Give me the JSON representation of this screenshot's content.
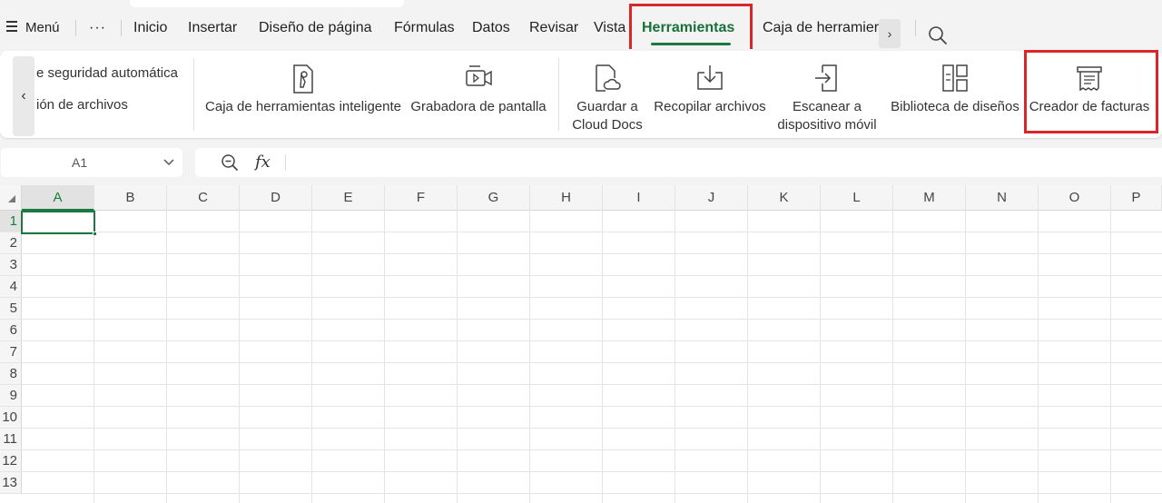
{
  "menubar": {
    "menu_label": "Menú",
    "more_label": "···",
    "tabs": [
      "Inicio",
      "Insertar",
      "Diseño de página",
      "Fórmulas",
      "Datos",
      "Revisar",
      "Vista",
      "Herramientas",
      "Caja de herramier"
    ],
    "active_tab": "Herramientas",
    "scroll_arrow": "›"
  },
  "ribbon": {
    "left_arrow": "‹",
    "partial_items": [
      "e seguridad automática",
      "ión de archivos"
    ],
    "buttons": [
      {
        "label": "Caja de herramientas inteligente",
        "icon": "smart-toolbox-icon"
      },
      {
        "label": "Grabadora de pantalla",
        "icon": "screen-recorder-icon"
      },
      {
        "label": "Guardar a",
        "label2": "Cloud Docs",
        "icon": "cloud-save-icon"
      },
      {
        "label": "Recopilar archivos",
        "icon": "collect-files-icon"
      },
      {
        "label": "Escanear a",
        "label2": "dispositivo móvil",
        "icon": "scan-to-mobile-icon"
      },
      {
        "label": "Biblioteca de diseños",
        "icon": "design-library-icon"
      },
      {
        "label": "Creador de facturas",
        "icon": "invoice-creator-icon"
      }
    ]
  },
  "formula_bar": {
    "cell_ref": "A1",
    "fx_label": "fx",
    "formula": ""
  },
  "sheet": {
    "columns": [
      "A",
      "B",
      "C",
      "D",
      "E",
      "F",
      "G",
      "H",
      "I",
      "J",
      "K",
      "L",
      "M",
      "N",
      "O",
      "P"
    ],
    "rows": [
      "1",
      "2",
      "3",
      "4",
      "5",
      "6",
      "7",
      "8",
      "9",
      "10",
      "11",
      "12",
      "13"
    ],
    "selected_cell": "A1"
  },
  "colors": {
    "accent": "#1a7a42",
    "highlight_box": "#d8262b"
  }
}
